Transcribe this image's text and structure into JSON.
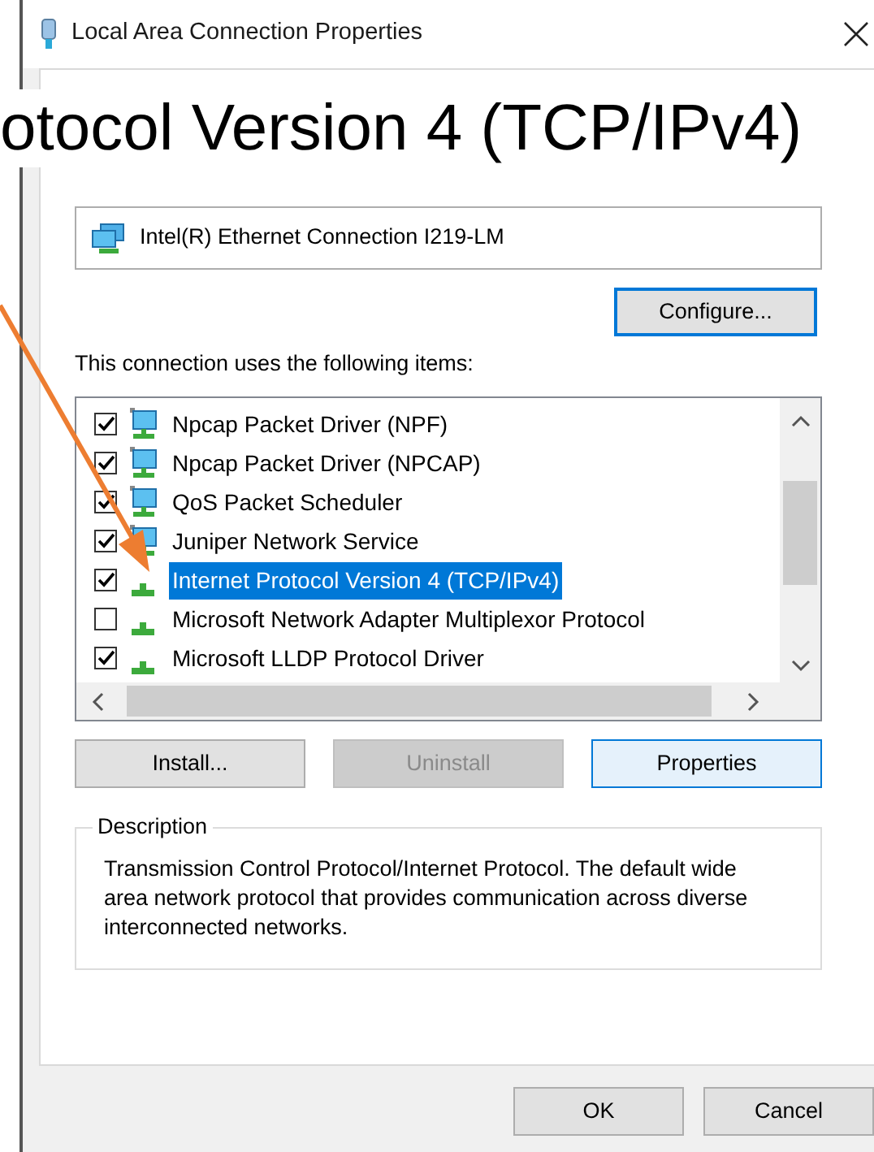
{
  "window": {
    "title": "Local Area Connection Properties"
  },
  "annotation": {
    "text": "otocol Version 4 (TCP/IPv4)"
  },
  "adapter": {
    "name": "Intel(R) Ethernet Connection I219-LM"
  },
  "configure_button": {
    "label": "Configure...",
    "focused": true
  },
  "items_label": "This connection uses the following items:",
  "items": [
    {
      "label": "Npcap Packet Driver (NPF)",
      "checked": true,
      "selected": false,
      "kind": "service"
    },
    {
      "label": "Npcap Packet Driver (NPCAP)",
      "checked": true,
      "selected": false,
      "kind": "service"
    },
    {
      "label": "QoS Packet Scheduler",
      "checked": true,
      "selected": false,
      "kind": "service"
    },
    {
      "label": "Juniper Network Service",
      "checked": true,
      "selected": false,
      "kind": "service"
    },
    {
      "label": "Internet Protocol Version 4 (TCP/IPv4)",
      "checked": true,
      "selected": true,
      "kind": "protocol"
    },
    {
      "label": "Microsoft Network Adapter Multiplexor Protocol",
      "checked": false,
      "selected": false,
      "kind": "protocol"
    },
    {
      "label": "Microsoft LLDP Protocol Driver",
      "checked": true,
      "selected": false,
      "kind": "protocol"
    }
  ],
  "buttons": [
    {
      "label": "Install...",
      "disabled": false,
      "focused": false
    },
    {
      "label": "Uninstall",
      "disabled": true,
      "focused": false
    },
    {
      "label": "Properties",
      "disabled": false,
      "focused": true
    }
  ],
  "description": {
    "legend": "Description",
    "text": "Transmission Control Protocol/Internet Protocol. The default wide area network protocol that provides communication across diverse interconnected networks."
  },
  "footer_buttons": [
    {
      "label": "OK"
    },
    {
      "label": "Cancel"
    }
  ]
}
